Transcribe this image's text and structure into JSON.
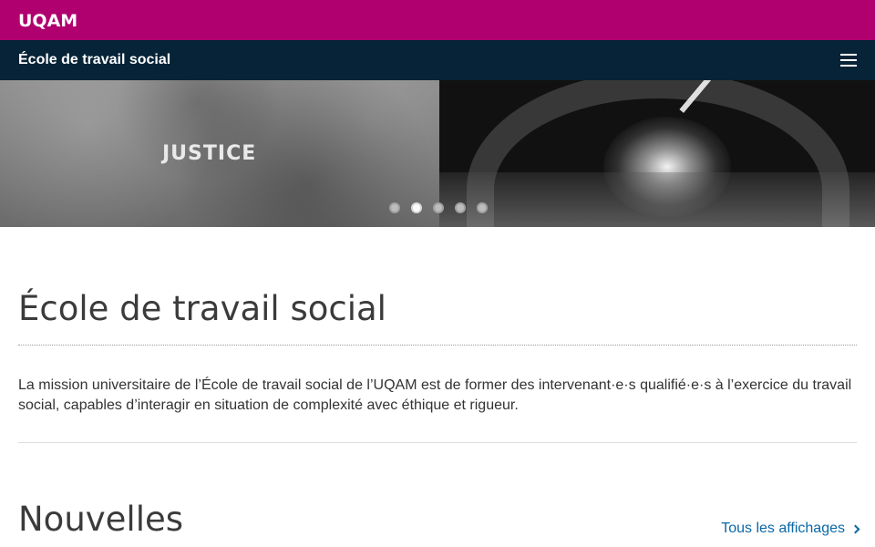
{
  "header": {
    "logo_text": "UQAM",
    "unit_name": "École de travail social",
    "menu_icon": "hamburger-menu-icon"
  },
  "hero": {
    "slide_text": "JUSTICE",
    "slides": [
      {
        "active": false
      },
      {
        "active": true
      },
      {
        "active": false
      },
      {
        "active": false
      },
      {
        "active": false
      }
    ]
  },
  "main": {
    "title": "École de travail social",
    "mission": "La mission universitaire de l’École de travail social de l’UQAM est de former des intervenant·e·s qualifié·e·s à l’exercice du travail social, capables d’interagir en situation de complexité avec éthique et rigueur."
  },
  "news": {
    "title": "Nouvelles",
    "link_label": "Tous les affichages",
    "link_icon": "chevron-right-icon"
  },
  "colors": {
    "brand": "#b0006f",
    "navy": "#062337",
    "link": "#0a68a6"
  }
}
